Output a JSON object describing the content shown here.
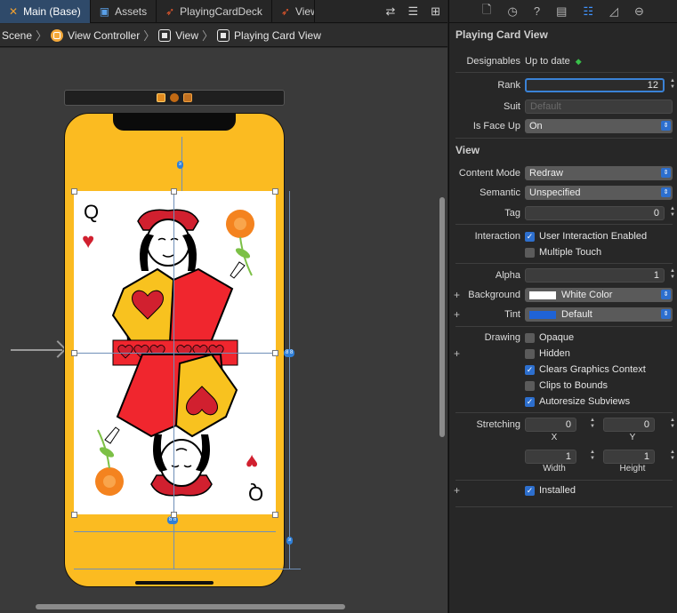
{
  "tabs": [
    {
      "label": "Main (Base)",
      "icon": "storyboard-icon",
      "active": true
    },
    {
      "label": "Assets",
      "icon": "assets-icon",
      "active": false
    },
    {
      "label": "PlayingCardDeck",
      "icon": "swift-icon",
      "active": false
    },
    {
      "label": "View",
      "icon": "swift-icon",
      "active": false
    }
  ],
  "breadcrumb": [
    "Scene",
    "View Controller",
    "View",
    "Playing Card View"
  ],
  "card": {
    "rank": "Q",
    "suit": "♥",
    "suit_color": "#d1202f"
  },
  "canvas": {
    "device_color": "#fbbb21",
    "card_color": "#ffffff",
    "guide_color": "#6f8fb8"
  },
  "badges": {
    "top": "≥",
    "right": "8 8",
    "bottom": "8 8",
    "side": "≥"
  },
  "inspector": {
    "title": "Playing Card View",
    "designables_label": "Designables",
    "designables_value": "Up to date",
    "rank_label": "Rank",
    "rank_value": "12",
    "suit_label": "Suit",
    "suit_placeholder": "Default",
    "faceup_label": "Is Face Up",
    "faceup_value": "On",
    "view_section": "View",
    "content_mode_label": "Content Mode",
    "content_mode_value": "Redraw",
    "semantic_label": "Semantic",
    "semantic_value": "Unspecified",
    "tag_label": "Tag",
    "tag_value": "0",
    "interaction_label": "Interaction",
    "user_interaction": "User Interaction Enabled",
    "multiple_touch": "Multiple Touch",
    "alpha_label": "Alpha",
    "alpha_value": "1",
    "background_label": "Background",
    "background_value": "White Color",
    "tint_label": "Tint",
    "tint_value": "Default",
    "tint_color": "#1f63d6",
    "drawing_label": "Drawing",
    "opaque": "Opaque",
    "hidden": "Hidden",
    "clears": "Clears Graphics Context",
    "clips": "Clips to Bounds",
    "autoresize": "Autoresize Subviews",
    "stretching_label": "Stretching",
    "stretch_x": "0",
    "stretch_y": "0",
    "stretch_w": "1",
    "stretch_h": "1",
    "x_label": "X",
    "y_label": "Y",
    "w_label": "Width",
    "h_label": "Height",
    "installed": "Installed"
  }
}
